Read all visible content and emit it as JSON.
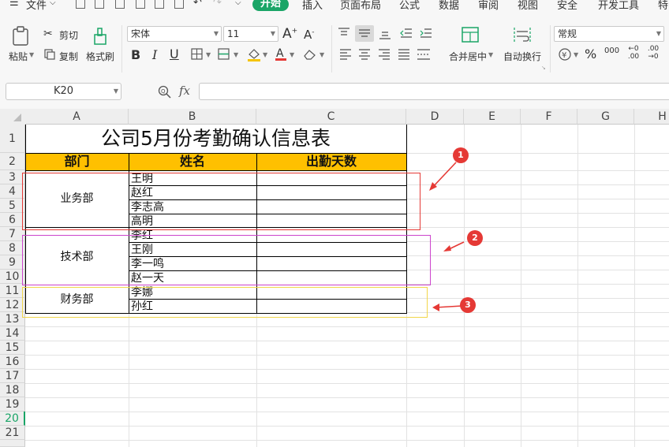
{
  "menubar": {
    "file_label": "文件",
    "items": [
      "开始",
      "插入",
      "页面布局",
      "公式",
      "数据",
      "审阅",
      "视图",
      "安全",
      "开发工具",
      "特"
    ]
  },
  "ribbon": {
    "paste": "粘贴",
    "cut": "剪切",
    "copy": "复制",
    "format_painter": "格式刷",
    "font_name": "宋体",
    "font_size": "11",
    "merge_center": "合并居中",
    "wrap_text": "自动换行",
    "number_format": "常规",
    "percent_symbol": "%",
    "thousands_symbol": "000",
    "dec_increase": "←0 .00",
    "dec_decrease": ".00 →0"
  },
  "formula_bar": {
    "cell_ref": "K20",
    "fx_label": "fx",
    "value": ""
  },
  "columns": [
    "A",
    "B",
    "C",
    "D",
    "E",
    "F",
    "G",
    "H"
  ],
  "rows": [
    "1",
    "2",
    "3",
    "4",
    "5",
    "6",
    "7",
    "8",
    "9",
    "10",
    "11",
    "12",
    "13",
    "14",
    "15",
    "16",
    "17",
    "18",
    "19",
    "20",
    "21"
  ],
  "selected_row": "20",
  "sheet": {
    "title": "公司5月份考勤确认信息表",
    "headers": [
      "部门",
      "姓名",
      "出勤天数"
    ],
    "departments": [
      "业务部",
      "技术部",
      "财务部"
    ],
    "names": [
      "王明",
      "赵红",
      "李志高",
      "高明",
      "李红",
      "王刚",
      "李一鸣",
      "赵一天",
      "李娜",
      "孙红"
    ]
  },
  "annotations": {
    "badges": [
      "1",
      "2",
      "3"
    ],
    "colors": [
      "#e53935",
      "#cc44cc",
      "#f2d64b"
    ]
  },
  "colors": {
    "accent_green": "#1aa567",
    "header_fill": "#ffc000",
    "arrow_red": "#e53935"
  }
}
